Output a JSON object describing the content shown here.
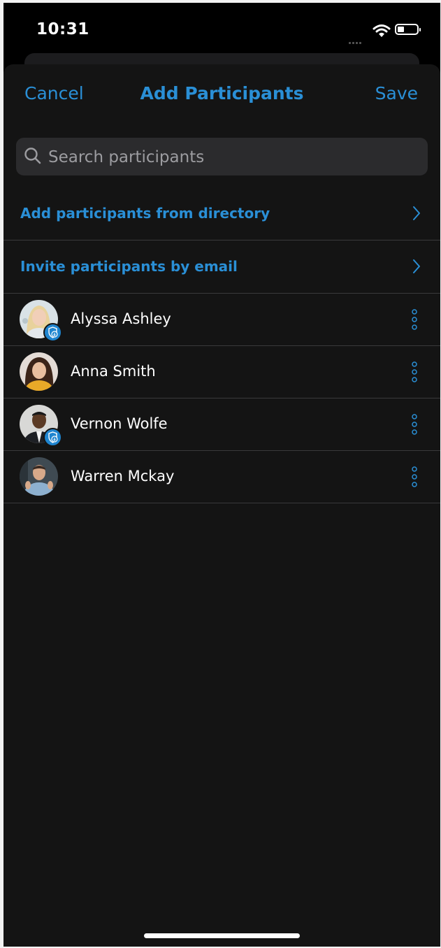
{
  "status_bar": {
    "time": "10:31"
  },
  "header": {
    "cancel_label": "Cancel",
    "title": "Add Participants",
    "save_label": "Save"
  },
  "search": {
    "placeholder": "Search participants",
    "value": ""
  },
  "actions": [
    {
      "label": "Add participants from directory"
    },
    {
      "label": "Invite participants by email"
    }
  ],
  "participants": [
    {
      "name": "Alyssa Ashley",
      "badge": "shield-download-icon"
    },
    {
      "name": "Anna Smith"
    },
    {
      "name": "Vernon Wolfe",
      "badge": "shield-download-icon"
    },
    {
      "name": "Warren Mckay"
    }
  ],
  "colors": {
    "accent": "#2a8fd6",
    "background": "#141414",
    "divider": "#3a3a3c",
    "search_field": "#2b2b2d"
  }
}
